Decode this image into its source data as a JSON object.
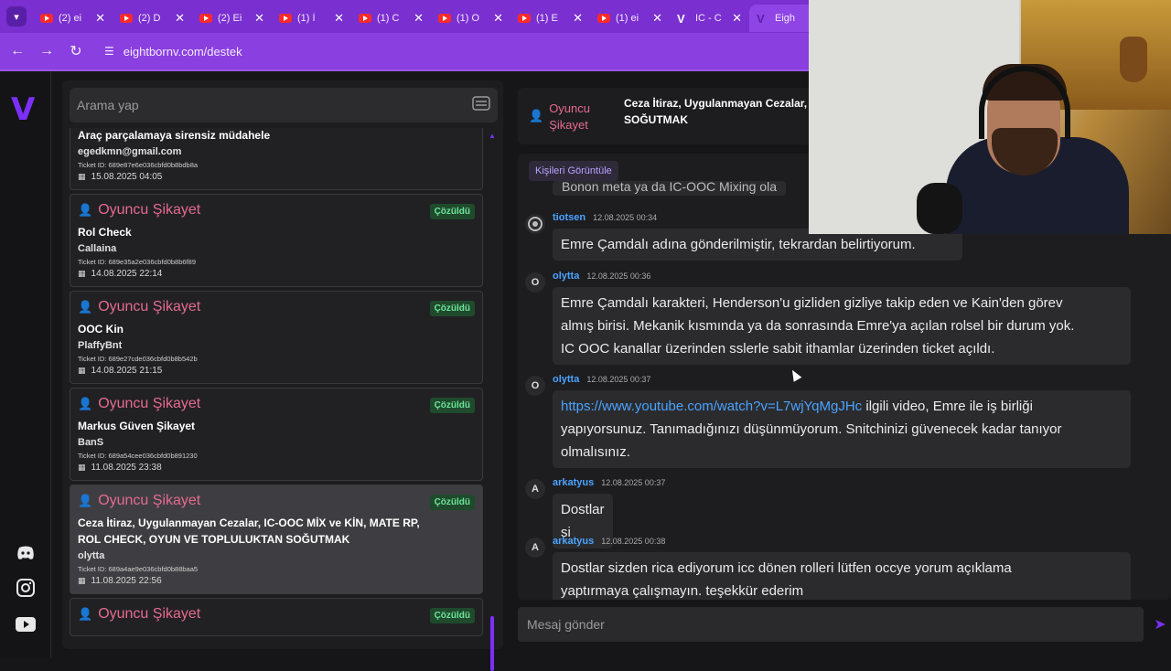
{
  "browser": {
    "tabs": [
      {
        "title": "(2) ei",
        "icon": "youtube-icon"
      },
      {
        "title": "(2) D",
        "icon": "youtube-icon"
      },
      {
        "title": "(2) Ei",
        "icon": "youtube-icon"
      },
      {
        "title": "(1) İ",
        "icon": "youtube-icon"
      },
      {
        "title": "(1) C",
        "icon": "youtube-icon"
      },
      {
        "title": "(1) O",
        "icon": "youtube-icon"
      },
      {
        "title": "(1) E",
        "icon": "youtube-icon"
      },
      {
        "title": "(1) ei",
        "icon": "youtube-icon"
      },
      {
        "title": "IC - C",
        "icon": "v-logo-icon"
      },
      {
        "title": "Eigh",
        "icon": "v-logo-icon",
        "active": true
      }
    ],
    "url": "eightbornv.com/destek"
  },
  "search": {
    "placeholder": "Arama yap"
  },
  "tickets": [
    {
      "category": "",
      "title": "Araç parçalamaya sirensiz müdahele",
      "user": "egedkmn@gmail.com",
      "ticket_id": "Ticket ID: 689e87e6e036cbfd0b8bdb8a",
      "date": "15.08.2025 04:05",
      "status": ""
    },
    {
      "category": "Oyuncu Şikayet",
      "title": "Rol Check",
      "user": "Callaina",
      "ticket_id": "Ticket ID: 689e35a2e036cbfd0b8b6f89",
      "date": "14.08.2025 22:14",
      "status": "Çözüldü"
    },
    {
      "category": "Oyuncu Şikayet",
      "title": "OOC Kin",
      "user": "PlaffyBnt",
      "ticket_id": "Ticket ID: 689e27cde036cbfd0b8b542b",
      "date": "14.08.2025 21:15",
      "status": "Çözüldü"
    },
    {
      "category": "Oyuncu Şikayet",
      "title": "Markus Güven Şikayet",
      "user": "BanS",
      "ticket_id": "Ticket ID: 689a54cee036cbfd0b891230",
      "date": "11.08.2025 23:38",
      "status": "Çözüldü"
    },
    {
      "category": "Oyuncu Şikayet",
      "title": "Ceza İtiraz, Uygulanmayan Cezalar, IC-OOC MİX ve KİN, MATE RP, ROL CHECK, OYUN VE TOPLULUKTAN SOĞUTMAK",
      "user": "olytta",
      "ticket_id": "Ticket ID: 689a4ae9e036cbfd0b88baa5",
      "date": "11.08.2025 22:56",
      "status": "Çözüldü"
    },
    {
      "category": "Oyuncu Şikayet",
      "title": "",
      "user": "",
      "ticket_id": "",
      "date": "",
      "status": "Çözüldü"
    }
  ],
  "conversation": {
    "category_line1": "Oyuncu",
    "category_line2": "Şikayet",
    "title_line1": "Ceza İtiraz, Uygulanmayan Cezalar,",
    "title_line2": "SOĞUTMAK",
    "people_button": "Kişileri Görüntüle",
    "partial_message": "Bonon meta ya da IC-OOC Mixing ola",
    "messages": [
      {
        "avatar": "",
        "name": "tiotsen",
        "time": "12.08.2025 00:34",
        "lines": [
          "Emre Çamdalı adına gönderilmiştir, tekrardan belirtiyorum."
        ]
      },
      {
        "avatar": "O",
        "name": "olytta",
        "time": "12.08.2025 00:36",
        "lines": [
          "Emre Çamdalı karakteri, Henderson'u gizliden gizliye takip eden ve Kain'den görev",
          "almış birisi. Mekanik kısmında ya da sonrasında Emre'ya açılan rolsel bir durum yok.",
          "IC OOC kanallar üzerinden sslerle sabit ithamlar üzerinden ticket açıldı."
        ]
      },
      {
        "avatar": "O",
        "name": "olytta",
        "time": "12.08.2025 00:37",
        "link": "https://www.youtube.com/watch?v=L7wjYqMgJHc",
        "link_tail": " ilgili video, Emre ile iş birliği",
        "lines": [
          "yapıyorsunuz. Tanımadığınızı düşünmüyorum. Snitchinizi güvenecek kadar tanıyor",
          "olmalısınız."
        ]
      },
      {
        "avatar": "A",
        "name": "arkatyus",
        "time": "12.08.2025 00:37",
        "lines": [
          "Dostlar si"
        ]
      },
      {
        "avatar": "A",
        "name": "arkatyus",
        "time": "12.08.2025 00:38",
        "lines": [
          "Dostlar sizden rica ediyorum icc dönen rolleri lütfen occye yorum açıklama",
          "yaptırmaya çalışmayın. teşekkür ederim"
        ]
      }
    ]
  },
  "composer": {
    "placeholder": "Mesaj gönder"
  },
  "colors": {
    "accent": "#7b2ff7",
    "category": "#e66a8e",
    "resolved": "#6ee39a",
    "link": "#4aa3ff"
  }
}
